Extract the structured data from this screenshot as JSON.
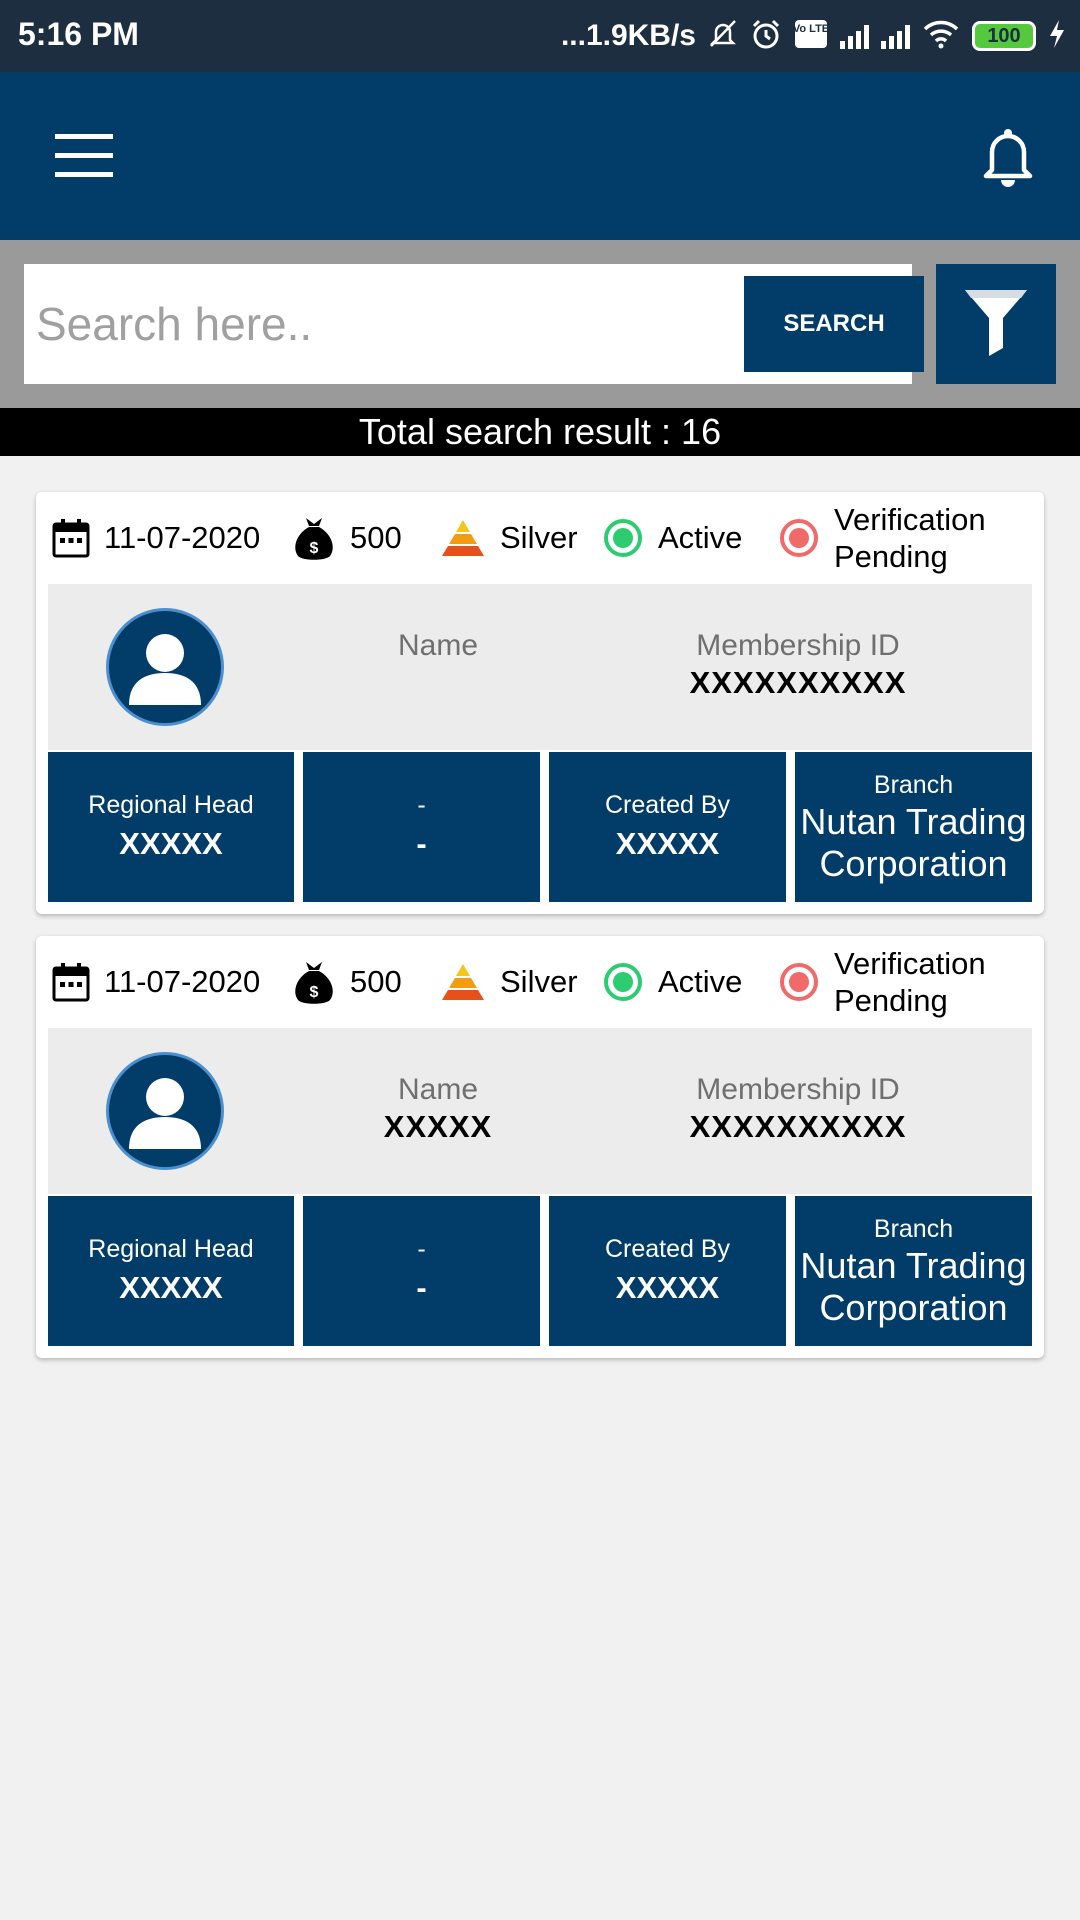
{
  "status_bar": {
    "time": "5:16 PM",
    "net_speed": "...1.9KB/s",
    "volte_label": "Vo LTE",
    "battery": "100",
    "icons": [
      "mute-bell-icon",
      "alarm-icon",
      "volte-icon",
      "signal-icon",
      "signal-icon",
      "wifi-icon",
      "battery-icon",
      "charging-icon"
    ]
  },
  "app_bar": {
    "icons": [
      "menu-icon",
      "bell-icon"
    ]
  },
  "search": {
    "placeholder": "Search here..",
    "value": "",
    "button_label": "SEARCH",
    "filter_icon": "filter-icon"
  },
  "results": {
    "label": "Total search result : 16"
  },
  "cards": [
    {
      "date": "11-07-2020",
      "amount": "500",
      "tier": "Silver",
      "status": "Active",
      "verification_line1": "Verification",
      "verification_line2": "Pending",
      "name_label": "Name",
      "name_value": "",
      "membership_label": "Membership ID",
      "membership_value": "XXXXXXXXXX",
      "regional_head_label": "Regional Head",
      "regional_head_value": "XXXXX",
      "dash_label": "-",
      "dash_value": "-",
      "created_by_label": "Created By",
      "created_by_value": "XXXXX",
      "branch_label": "Branch",
      "branch_line1": "Nutan Trading",
      "branch_line2": "Corporation"
    },
    {
      "date": "11-07-2020",
      "amount": "500",
      "tier": "Silver",
      "status": "Active",
      "verification_line1": "Verification",
      "verification_line2": "Pending",
      "name_label": "Name",
      "name_value": "XXXXX",
      "membership_label": "Membership ID",
      "membership_value": "XXXXXXXXXX",
      "regional_head_label": "Regional Head",
      "regional_head_value": "XXXXX",
      "dash_label": "-",
      "dash_value": "-",
      "created_by_label": "Created By",
      "created_by_value": "XXXXX",
      "branch_label": "Branch",
      "branch_line1": "Nutan Trading",
      "branch_line2": "Corporation"
    }
  ],
  "colors": {
    "primary": "#023c68",
    "status_bar": "#1c2e40",
    "search_bg": "#9a9a9a",
    "active_green": "#2ecc71",
    "pending_red": "#f06a6a",
    "tier_orange": "#f39c12",
    "battery_green": "#54c93e"
  }
}
